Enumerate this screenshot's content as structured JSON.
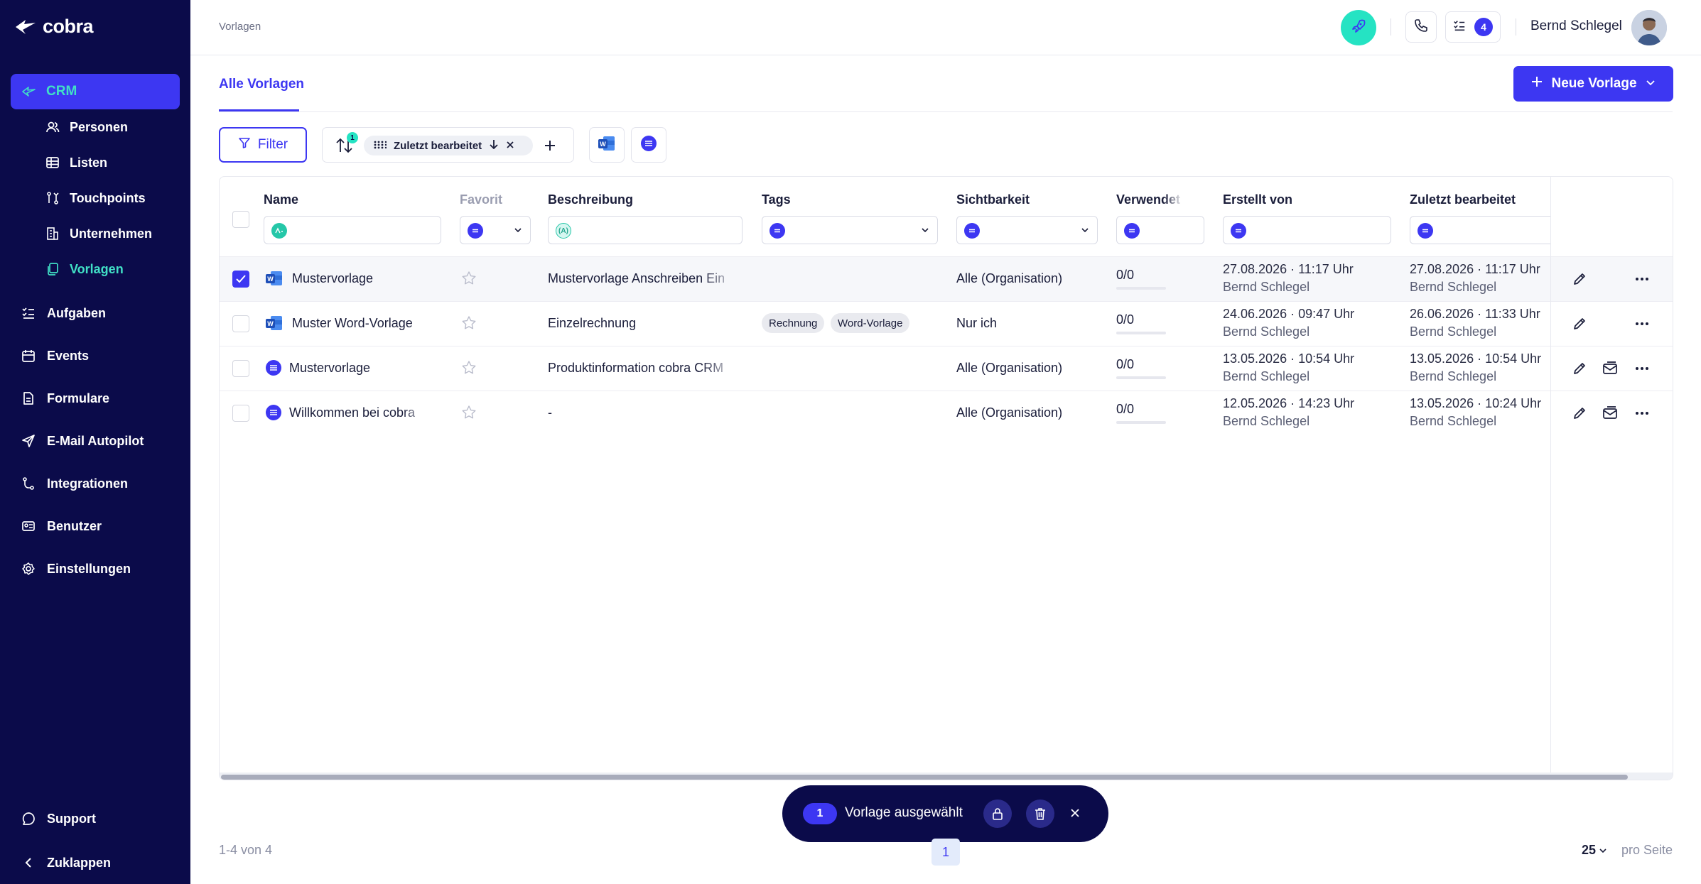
{
  "app": {
    "logo_text": "cobra"
  },
  "sidebar": {
    "crm_label": "CRM",
    "sub_items": [
      {
        "label": "Personen",
        "icon": "persons-icon"
      },
      {
        "label": "Listen",
        "icon": "table-icon"
      },
      {
        "label": "Touchpoints",
        "icon": "touchpoints-icon"
      },
      {
        "label": "Unternehmen",
        "icon": "building-icon"
      },
      {
        "label": "Vorlagen",
        "icon": "copy-icon"
      }
    ],
    "main_items": [
      {
        "label": "Aufgaben",
        "icon": "tasks-icon"
      },
      {
        "label": "Events",
        "icon": "calendar-icon"
      },
      {
        "label": "Formulare",
        "icon": "form-icon"
      },
      {
        "label": "E-Mail Autopilot",
        "icon": "send-icon"
      },
      {
        "label": "Integrationen",
        "icon": "integration-icon"
      },
      {
        "label": "Benutzer",
        "icon": "user-card-icon"
      },
      {
        "label": "Einstellungen",
        "icon": "gear-icon"
      }
    ],
    "support_label": "Support",
    "collapse_label": "Zuklappen"
  },
  "topbar": {
    "breadcrumb": "Vorlagen",
    "tasks_badge": "4",
    "user_name": "Bernd Schlegel"
  },
  "tabs": {
    "active": "Alle Vorlagen"
  },
  "actions": {
    "new_button": "Neue Vorlage"
  },
  "toolbar": {
    "filter_label": "Filter",
    "sort_badge": "1",
    "sort_chip": "Zuletzt bearbeitet"
  },
  "table": {
    "columns": [
      "Name",
      "Favorit",
      "Beschreibung",
      "Tags",
      "Sichtbarkeit",
      "Verwendet",
      "Erstellt von",
      "Zuletzt bearbeitet"
    ],
    "rows": [
      {
        "checked": true,
        "type": "word",
        "name": "Mustervorlage",
        "description": "Mustervorlage Anschreiben Ein",
        "tags": [],
        "visibility": "Alle (Organisation)",
        "used": "0/0",
        "created_date": "27.08.2026 · 11:17 Uhr",
        "created_by": "Bernd Schlegel",
        "edited_date": "27.08.2026 · 11:17 Uhr",
        "edited_by": "Bernd Schlegel"
      },
      {
        "checked": false,
        "type": "word",
        "name": "Muster Word-Vorlage",
        "description": "Einzelrechnung",
        "tags": [
          "Rechnung",
          "Word-Vorlage"
        ],
        "visibility": "Nur ich",
        "used": "0/0",
        "created_date": "24.06.2026 · 09:47 Uhr",
        "created_by": "Bernd Schlegel",
        "edited_date": "26.06.2026 · 11:33 Uhr",
        "edited_by": "Bernd Schlegel"
      },
      {
        "checked": false,
        "type": "email",
        "name": "Mustervorlage",
        "description": "Produktinformation cobra CRM",
        "tags": [],
        "visibility": "Alle (Organisation)",
        "used": "0/0",
        "created_date": "13.05.2026 · 10:54 Uhr",
        "created_by": "Bernd Schlegel",
        "edited_date": "13.05.2026 · 10:54 Uhr",
        "edited_by": "Bernd Schlegel"
      },
      {
        "checked": false,
        "type": "email",
        "name": "Willkommen bei cobra",
        "description": "-",
        "tags": [],
        "visibility": "Alle (Organisation)",
        "used": "0/0",
        "created_date": "12.05.2026 · 14:23 Uhr",
        "created_by": "Bernd Schlegel",
        "edited_date": "13.05.2026 · 10:24 Uhr",
        "edited_by": "Bernd Schlegel"
      }
    ]
  },
  "selection": {
    "count": "1",
    "text": "Vorlage ausgewählt"
  },
  "footer": {
    "range": "1-4 von 4",
    "page": "1",
    "per_page_value": "25",
    "per_page_label": "pro Seite"
  },
  "colors": {
    "sidebar": "#0b0b4a",
    "accent": "#3d37f2",
    "teal": "#25e3c3"
  }
}
